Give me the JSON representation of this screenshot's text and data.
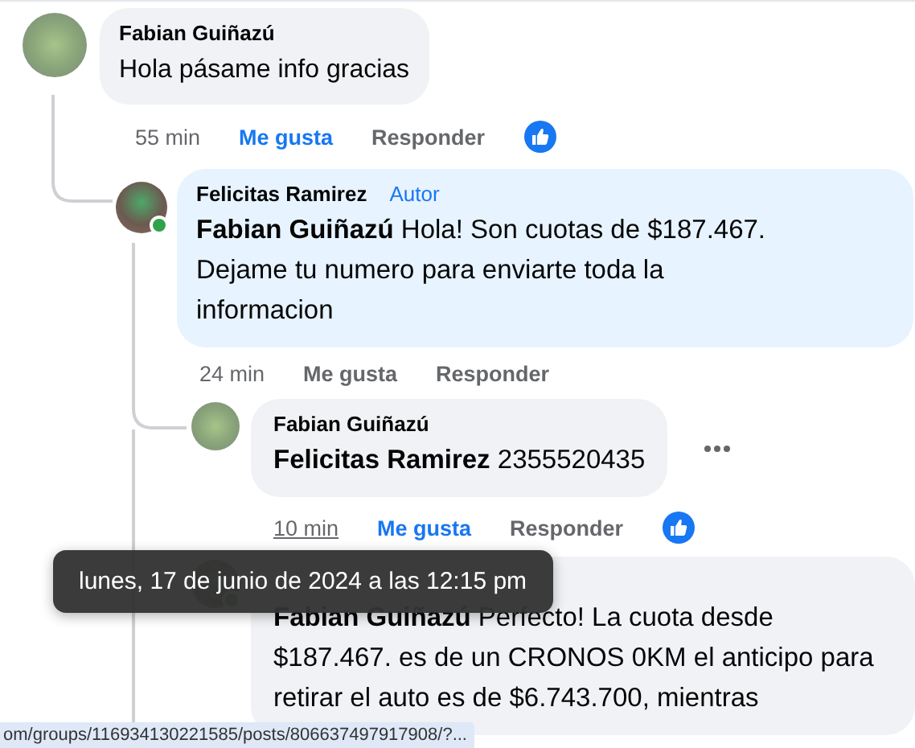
{
  "comments": [
    {
      "author": "Fabian Guiñazú",
      "text": "Hola pásame info gracias",
      "online": false,
      "time": "55 min",
      "like_label": "Me gusta",
      "liked": true,
      "reply_label": "Responder",
      "reaction": true,
      "hovered": false,
      "children": [
        {
          "author": "Felicitas Ramirez",
          "badge": "Autor",
          "mention": "Fabian Guiñazú",
          "text": "Hola! Son cuotas de $187.467. Dejame tu numero para enviarte toda la informacion",
          "online": true,
          "time": "24 min",
          "like_label": "Me gusta",
          "liked": false,
          "reply_label": "Responder",
          "reaction": false,
          "hovered": false,
          "children": [
            {
              "author": "Fabian Guiñazú",
              "mention": "Felicitas Ramirez",
              "text": "2355520435",
              "online": false,
              "time": "10 min",
              "like_label": "Me gusta",
              "liked": true,
              "reply_label": "Responder",
              "reaction": true,
              "hovered": true
            },
            {
              "mention": "Fabian Guiñazú",
              "text": "Perfecto! La cuota desde $187.467. es de un CRONOS 0KM el anticipo para retirar el auto es de $6.743.700, mientras",
              "online": true,
              "hovered": false
            }
          ]
        }
      ]
    }
  ],
  "tooltip": "lunes, 17 de junio de 2024 a las 12:15 pm",
  "status_bar": "om/groups/116934130221585/posts/806637497917908/?..."
}
